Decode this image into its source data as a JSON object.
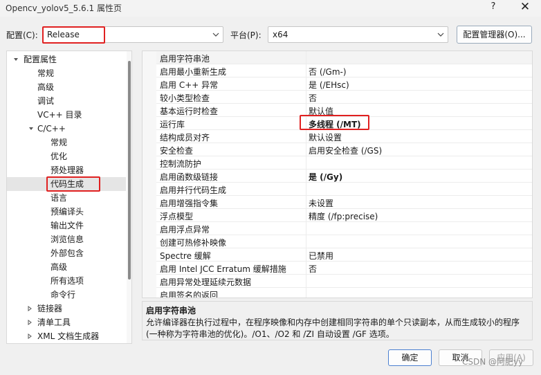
{
  "window": {
    "title": "Opencv_yolov5_5.6.1 属性页",
    "help_glyph": "?",
    "close_glyph": "✕"
  },
  "toolbar": {
    "config_label": "配置(C):",
    "config_value": "Release",
    "platform_label": "平台(P):",
    "platform_value": "x64",
    "config_manager_label": "配置管理器(O)..."
  },
  "tree": {
    "items": [
      {
        "label": "配置属性"
      },
      {
        "label": "常规"
      },
      {
        "label": "高级"
      },
      {
        "label": "调试"
      },
      {
        "label": "VC++ 目录"
      },
      {
        "label": "C/C++"
      },
      {
        "label": "常规"
      },
      {
        "label": "优化"
      },
      {
        "label": "预处理器"
      },
      {
        "label": "代码生成"
      },
      {
        "label": "语言"
      },
      {
        "label": "预编译头"
      },
      {
        "label": "输出文件"
      },
      {
        "label": "浏览信息"
      },
      {
        "label": "外部包含"
      },
      {
        "label": "高级"
      },
      {
        "label": "所有选项"
      },
      {
        "label": "命令行"
      },
      {
        "label": "链接器"
      },
      {
        "label": "清单工具"
      },
      {
        "label": "XML 文档生成器"
      }
    ]
  },
  "properties": [
    {
      "name": "启用字符串池",
      "value": ""
    },
    {
      "name": "启用最小重新生成",
      "value": "否 (/Gm-)"
    },
    {
      "name": "启用 C++ 异常",
      "value": "是 (/EHsc)"
    },
    {
      "name": "较小类型检查",
      "value": "否"
    },
    {
      "name": "基本运行时检查",
      "value": "默认值"
    },
    {
      "name": "运行库",
      "value": "多线程 (/MT)"
    },
    {
      "name": "结构成员对齐",
      "value": "默认设置"
    },
    {
      "name": "安全检查",
      "value": "启用安全检查 (/GS)"
    },
    {
      "name": "控制流防护",
      "value": ""
    },
    {
      "name": "启用函数级链接",
      "value": "是 (/Gy)"
    },
    {
      "name": "启用并行代码生成",
      "value": ""
    },
    {
      "name": "启用增强指令集",
      "value": "未设置"
    },
    {
      "name": "浮点模型",
      "value": "精度 (/fp:precise)"
    },
    {
      "name": "启用浮点异常",
      "value": ""
    },
    {
      "name": "创建可热修补映像",
      "value": ""
    },
    {
      "name": "Spectre 缓解",
      "value": "已禁用"
    },
    {
      "name": "启用 Intel JCC Erratum 缓解措施",
      "value": "否"
    },
    {
      "name": "启用异常处理延续元数据",
      "value": ""
    },
    {
      "name": "启用签名的返回",
      "value": ""
    }
  ],
  "description": {
    "title": "启用字符串池",
    "text": "允许编译器在执行过程中，在程序映像和内存中创建相同字符串的单个只读副本，从而生成较小的程序(一种称为字符串池的优化)。/O1、/O2 和 /ZI 自动设置 /GF 选项。"
  },
  "buttons": {
    "ok": "确定",
    "cancel": "取消",
    "apply": "应用(A)"
  },
  "watermark": "CSDN @阿肥yy",
  "colors": {
    "highlight": "#e02020",
    "selected_bg": "#e5e5e5",
    "primary_border": "#4a7fd0"
  }
}
